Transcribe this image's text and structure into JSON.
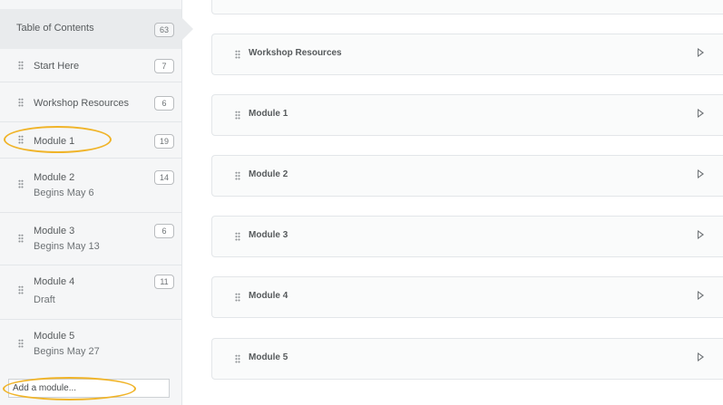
{
  "sidebar": {
    "toc": {
      "label": "Table of Contents",
      "count": "63"
    },
    "items": [
      {
        "label": "Start Here",
        "count": "7"
      },
      {
        "label": "Workshop Resources",
        "count": "6"
      },
      {
        "label": "Module 1",
        "count": "19"
      },
      {
        "label": "Module 2",
        "count": "14",
        "sub": "Begins May 6"
      },
      {
        "label": "Module 3",
        "count": "6",
        "sub": "Begins May 13"
      },
      {
        "label": "Module 4",
        "count": "11",
        "sub": "Draft"
      },
      {
        "label": "Module 5",
        "count": "",
        "sub": "Begins May 27"
      }
    ],
    "add_module_placeholder": "Add a module..."
  },
  "main": {
    "panels": [
      {
        "title": "Workshop Resources"
      },
      {
        "title": "Module 1"
      },
      {
        "title": "Module 2"
      },
      {
        "title": "Module 3"
      },
      {
        "title": "Module 4"
      },
      {
        "title": "Module 5"
      }
    ]
  },
  "colors": {
    "highlight_oval": "#f0b429",
    "sidebar_bg": "#f5f6f7"
  }
}
